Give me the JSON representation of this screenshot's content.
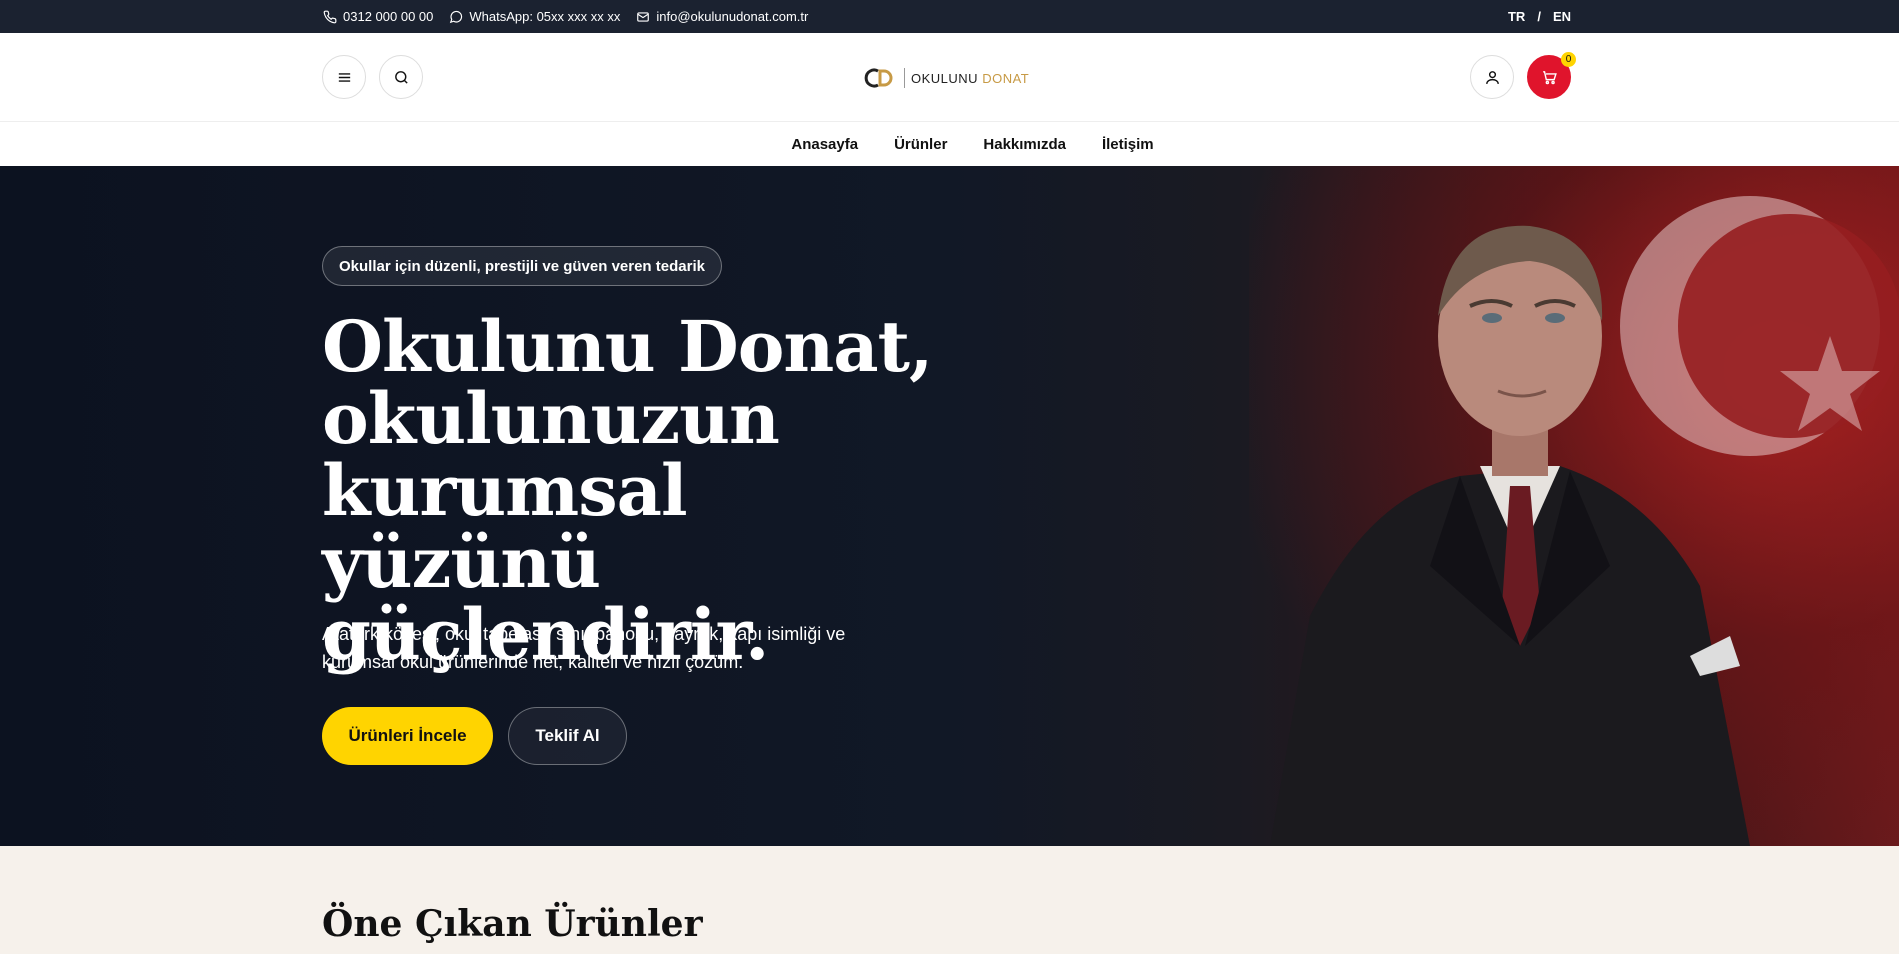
{
  "topbar": {
    "phone": "0312 000 00 00",
    "whatsapp": "WhatsApp: 05xx xxx xx xx",
    "email": "info@okulunudonat.com.tr",
    "lang_tr": "TR",
    "lang_sep": "/",
    "lang_en": "EN"
  },
  "header": {
    "logo_word1": "OKULUNU",
    "logo_word2": "DONAT",
    "cart_count": "0"
  },
  "nav": {
    "items": [
      {
        "label": "Anasayfa"
      },
      {
        "label": "Ürünler"
      },
      {
        "label": "Hakkımızda"
      },
      {
        "label": "İletişim"
      }
    ]
  },
  "hero": {
    "badge": "Okullar için düzenli, prestijli ve güven veren tedarik",
    "title": "Okulunu Donat, okulunuzun kurumsal yüzünü güçlendirir.",
    "subtitle": "Atatürk köşesi, okul tabelası, sınıf panosu, bayrak, kapı isimliği ve kurumsal okul ürünlerinde net, kaliteli ve hızlı çözüm.",
    "primary_button": "Ürünleri İncele",
    "secondary_button": "Teklif Al"
  },
  "section": {
    "title": "Öne Çıkan Ürünler"
  },
  "colors": {
    "topbar_bg": "#1b2230",
    "accent_yellow": "#ffd400",
    "cart_red": "#e0142c",
    "logo_gold": "#c79a45"
  }
}
